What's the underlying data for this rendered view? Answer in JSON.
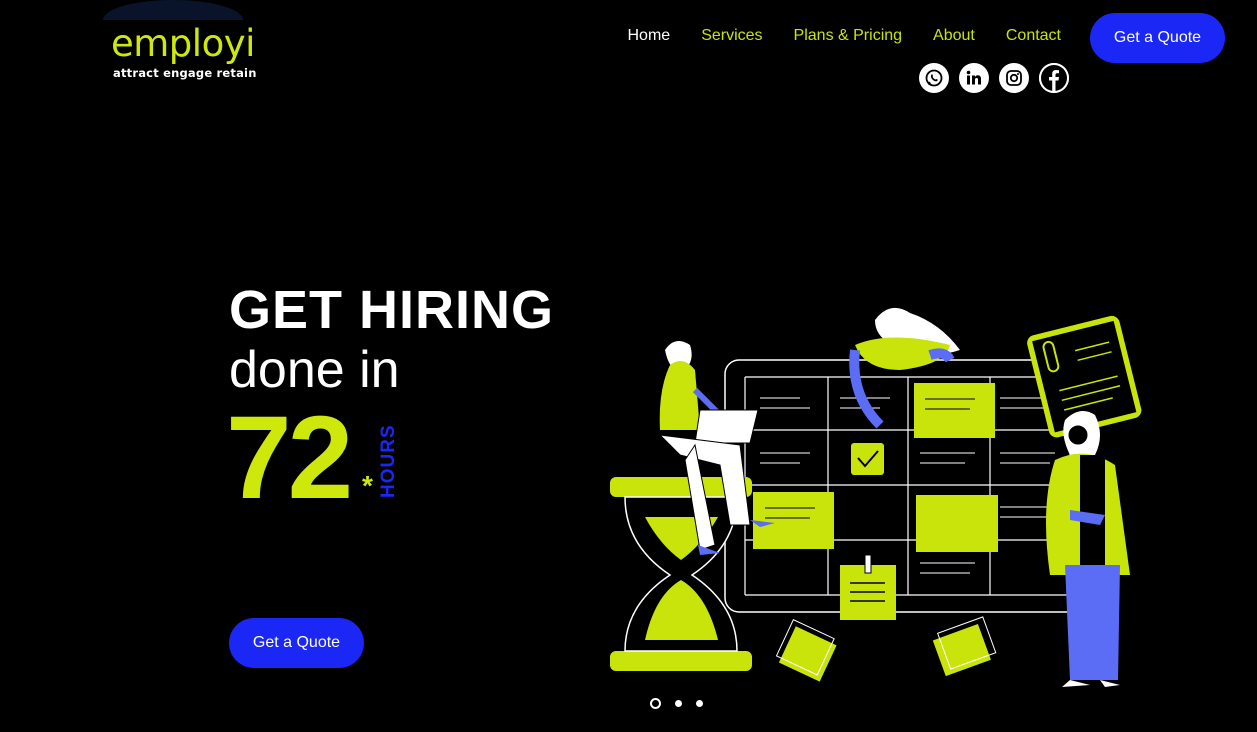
{
  "brand": {
    "name": "employi",
    "tagline": "attract engage retain",
    "accent": "#cde80a",
    "blue": "#1a27f5"
  },
  "nav": {
    "items": [
      {
        "label": "Home",
        "active": true
      },
      {
        "label": "Services",
        "active": false
      },
      {
        "label": "Plans & Pricing",
        "active": false
      },
      {
        "label": "About",
        "active": false
      },
      {
        "label": "Contact",
        "active": false
      }
    ],
    "cta": "Get a Quote"
  },
  "social": [
    "whatsapp-icon",
    "linkedin-icon",
    "instagram-icon",
    "facebook-icon"
  ],
  "hero": {
    "line1": "GET HIRING",
    "line2": "done in",
    "number": "72",
    "asterisk": "*",
    "unit": "HOURS",
    "cta": "Get a Quote"
  },
  "carousel": {
    "slides": 3,
    "active": 0
  }
}
